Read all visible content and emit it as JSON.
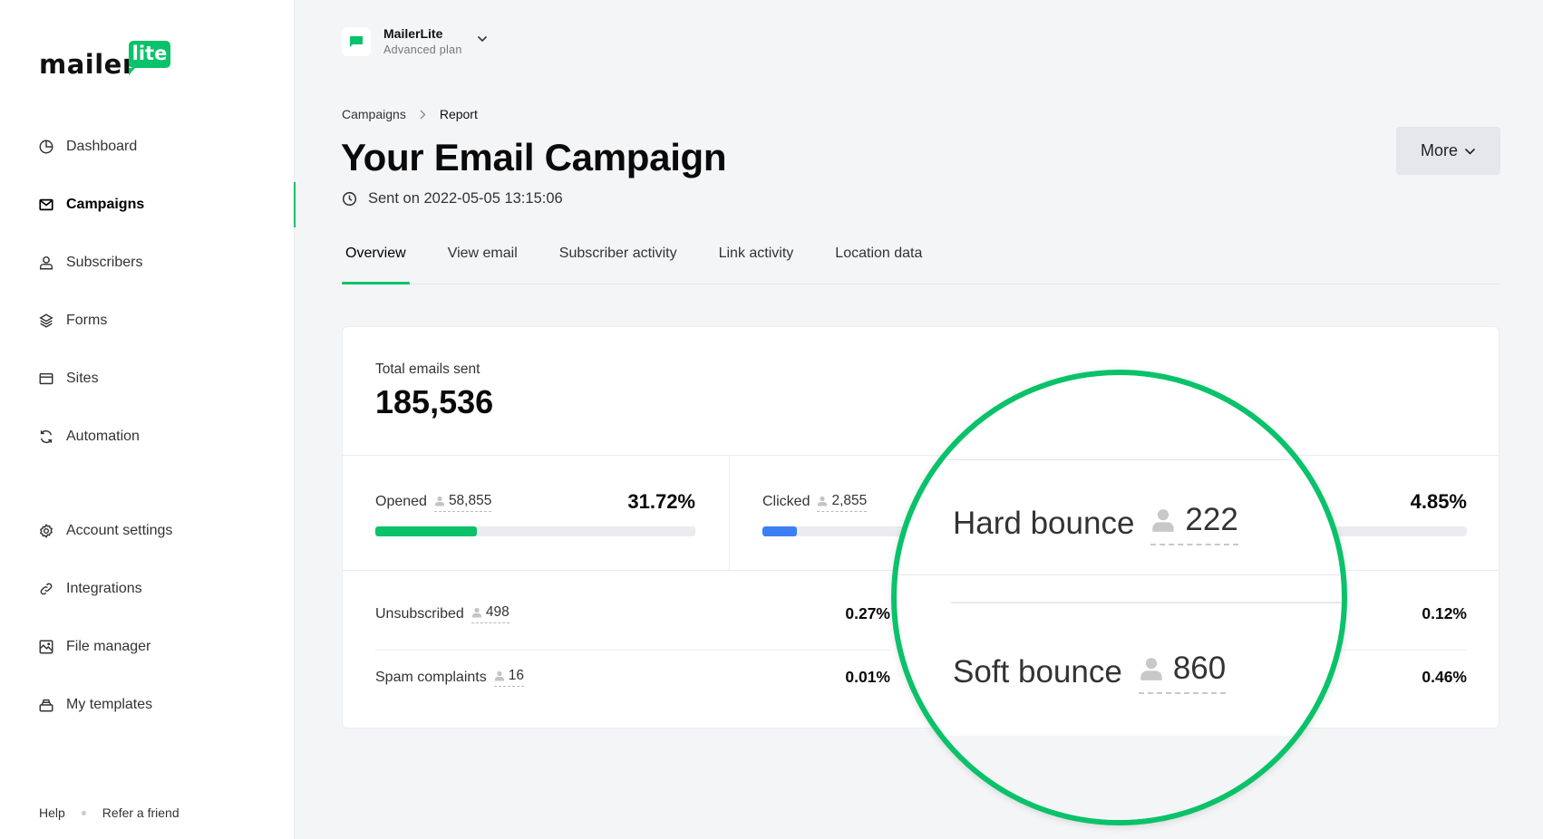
{
  "brand": {
    "logo_word": "mailer",
    "logo_badge": "lite",
    "accent_color": "#09c269"
  },
  "sidebar": {
    "primary_items": [
      {
        "label": "Dashboard",
        "icon": "pie-chart-icon",
        "active": false
      },
      {
        "label": "Campaigns",
        "icon": "envelope-icon",
        "active": true
      },
      {
        "label": "Subscribers",
        "icon": "user-icon",
        "active": false
      },
      {
        "label": "Forms",
        "icon": "layers-icon",
        "active": false
      },
      {
        "label": "Sites",
        "icon": "browser-window-icon",
        "active": false
      },
      {
        "label": "Automation",
        "icon": "refresh-icon",
        "active": false
      }
    ],
    "secondary_items": [
      {
        "label": "Account settings",
        "icon": "gear-icon"
      },
      {
        "label": "Integrations",
        "icon": "link-icon"
      },
      {
        "label": "File manager",
        "icon": "image-icon"
      },
      {
        "label": "My templates",
        "icon": "stack-icon"
      }
    ],
    "footer": {
      "help": "Help",
      "refer": "Refer a friend"
    }
  },
  "workspace": {
    "name": "MailerLite",
    "plan": "Advanced plan"
  },
  "breadcrumb": {
    "parent": "Campaigns",
    "current": "Report"
  },
  "header": {
    "title": "Your Email Campaign",
    "sent_on": "Sent on 2022-05-05 13:15:06",
    "more_label": "More"
  },
  "tabs": [
    {
      "label": "Overview",
      "active": true
    },
    {
      "label": "View email",
      "active": false
    },
    {
      "label": "Subscriber activity",
      "active": false
    },
    {
      "label": "Link activity",
      "active": false
    },
    {
      "label": "Location data",
      "active": false
    }
  ],
  "report": {
    "total_label": "Total emails sent",
    "total_value": "185,536",
    "opened": {
      "label": "Opened",
      "count": "58,855",
      "percent": "31.72%",
      "fraction": 0.3172,
      "color": "#09c269"
    },
    "clicked": {
      "label": "Clicked",
      "count": "2,855",
      "percent": "4.85%",
      "fraction": 0.0485,
      "color": "#3b7ff5"
    },
    "unsubscribed": {
      "label": "Unsubscribed",
      "count": "498",
      "percent": "0.27%"
    },
    "spam": {
      "label": "Spam complaints",
      "count": "16",
      "percent": "0.01%"
    },
    "hard_bounce": {
      "label": "Hard bounce",
      "count": "222",
      "percent": "0.12%"
    },
    "soft_bounce": {
      "label": "Soft bounce",
      "count": "860",
      "percent": "0.46%"
    }
  }
}
